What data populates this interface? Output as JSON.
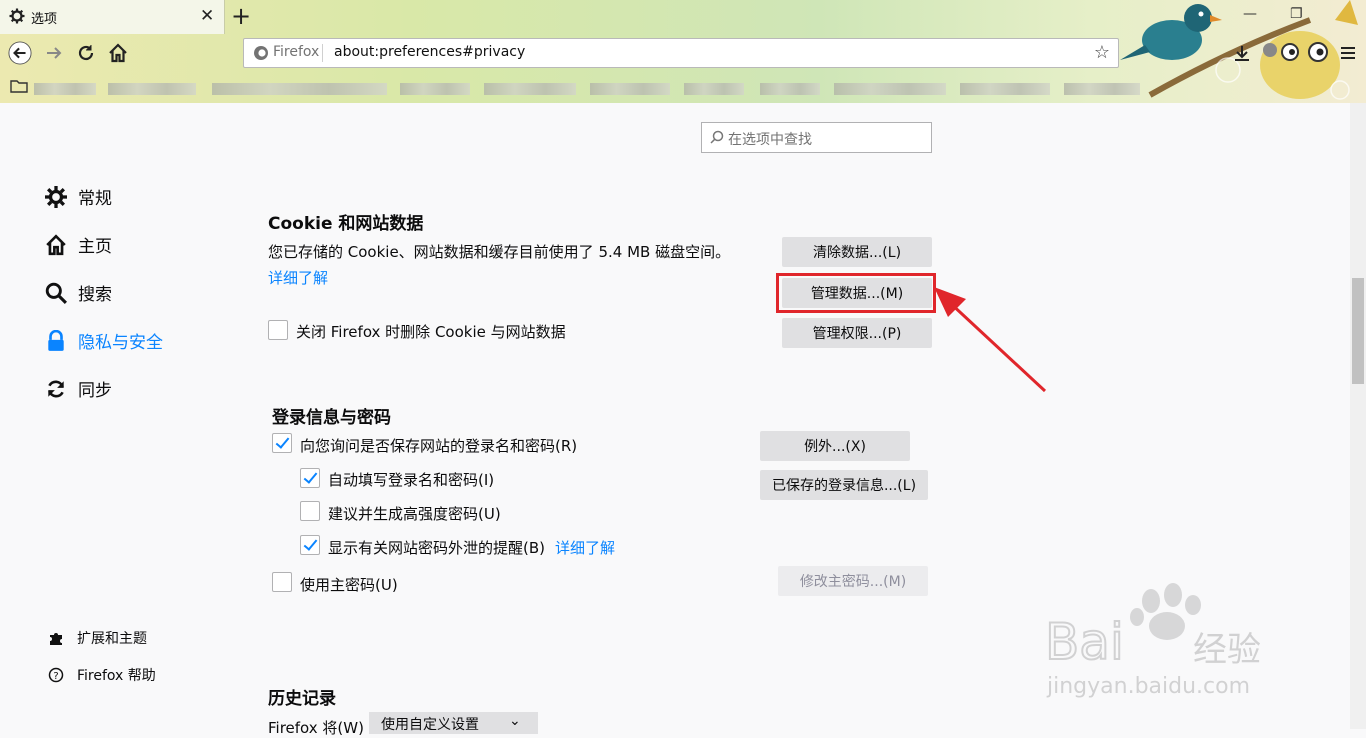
{
  "tab": {
    "title": "选项",
    "close": "✕",
    "new_tab": "+"
  },
  "window": {
    "minimize": "—",
    "restore": "❐"
  },
  "urlbar": {
    "identity_label": "Firefox",
    "url": "about:preferences#privacy"
  },
  "search": {
    "placeholder": "在选项中查找"
  },
  "sidebar": {
    "items": [
      {
        "label": "常规",
        "icon": "gear-icon"
      },
      {
        "label": "主页",
        "icon": "home-icon"
      },
      {
        "label": "搜索",
        "icon": "search-icon"
      },
      {
        "label": "隐私与安全",
        "icon": "lock-icon",
        "active": true
      },
      {
        "label": "同步",
        "icon": "sync-icon"
      }
    ],
    "footer": [
      {
        "label": "扩展和主题",
        "icon": "puzzle-icon"
      },
      {
        "label": "Firefox 帮助",
        "icon": "help-icon"
      }
    ]
  },
  "cookies": {
    "heading": "Cookie 和网站数据",
    "usage_text": "您已存储的 Cookie、网站数据和缓存目前使用了 5.4 MB 磁盘空间。",
    "learn_more": "详细了解",
    "clear_button": "清除数据...(L)",
    "manage_button": "管理数据...(M)",
    "permissions_button": "管理权限...(P)",
    "delete_on_close_label": "关闭 Firefox 时删除 Cookie 与网站数据",
    "delete_on_close_checked": false
  },
  "logins": {
    "heading": "登录信息与密码",
    "ask_save_label": "向您询问是否保存网站的登录名和密码(R)",
    "ask_save_checked": true,
    "autofill_label": "自动填写登录名和密码(I)",
    "autofill_checked": true,
    "generate_label": "建议并生成高强度密码(U)",
    "generate_checked": false,
    "breach_label": "显示有关网站密码外泄的提醒(B)",
    "breach_checked": true,
    "breach_learn_more": "详细了解",
    "master_label": "使用主密码(U)",
    "master_checked": false,
    "exceptions_button": "例外...(X)",
    "saved_logins_button": "已保存的登录信息...(L)",
    "change_master_button": "修改主密码...(M)"
  },
  "history": {
    "heading": "历史记录",
    "mode_label": "Firefox 将(W)",
    "mode_value": "使用自定义设置"
  },
  "watermark": {
    "text": "Bai",
    "text2": "经验",
    "url": "jingyan.baidu.com"
  },
  "colors": {
    "accent": "#0a84ff",
    "annotation": "#e0262b"
  }
}
